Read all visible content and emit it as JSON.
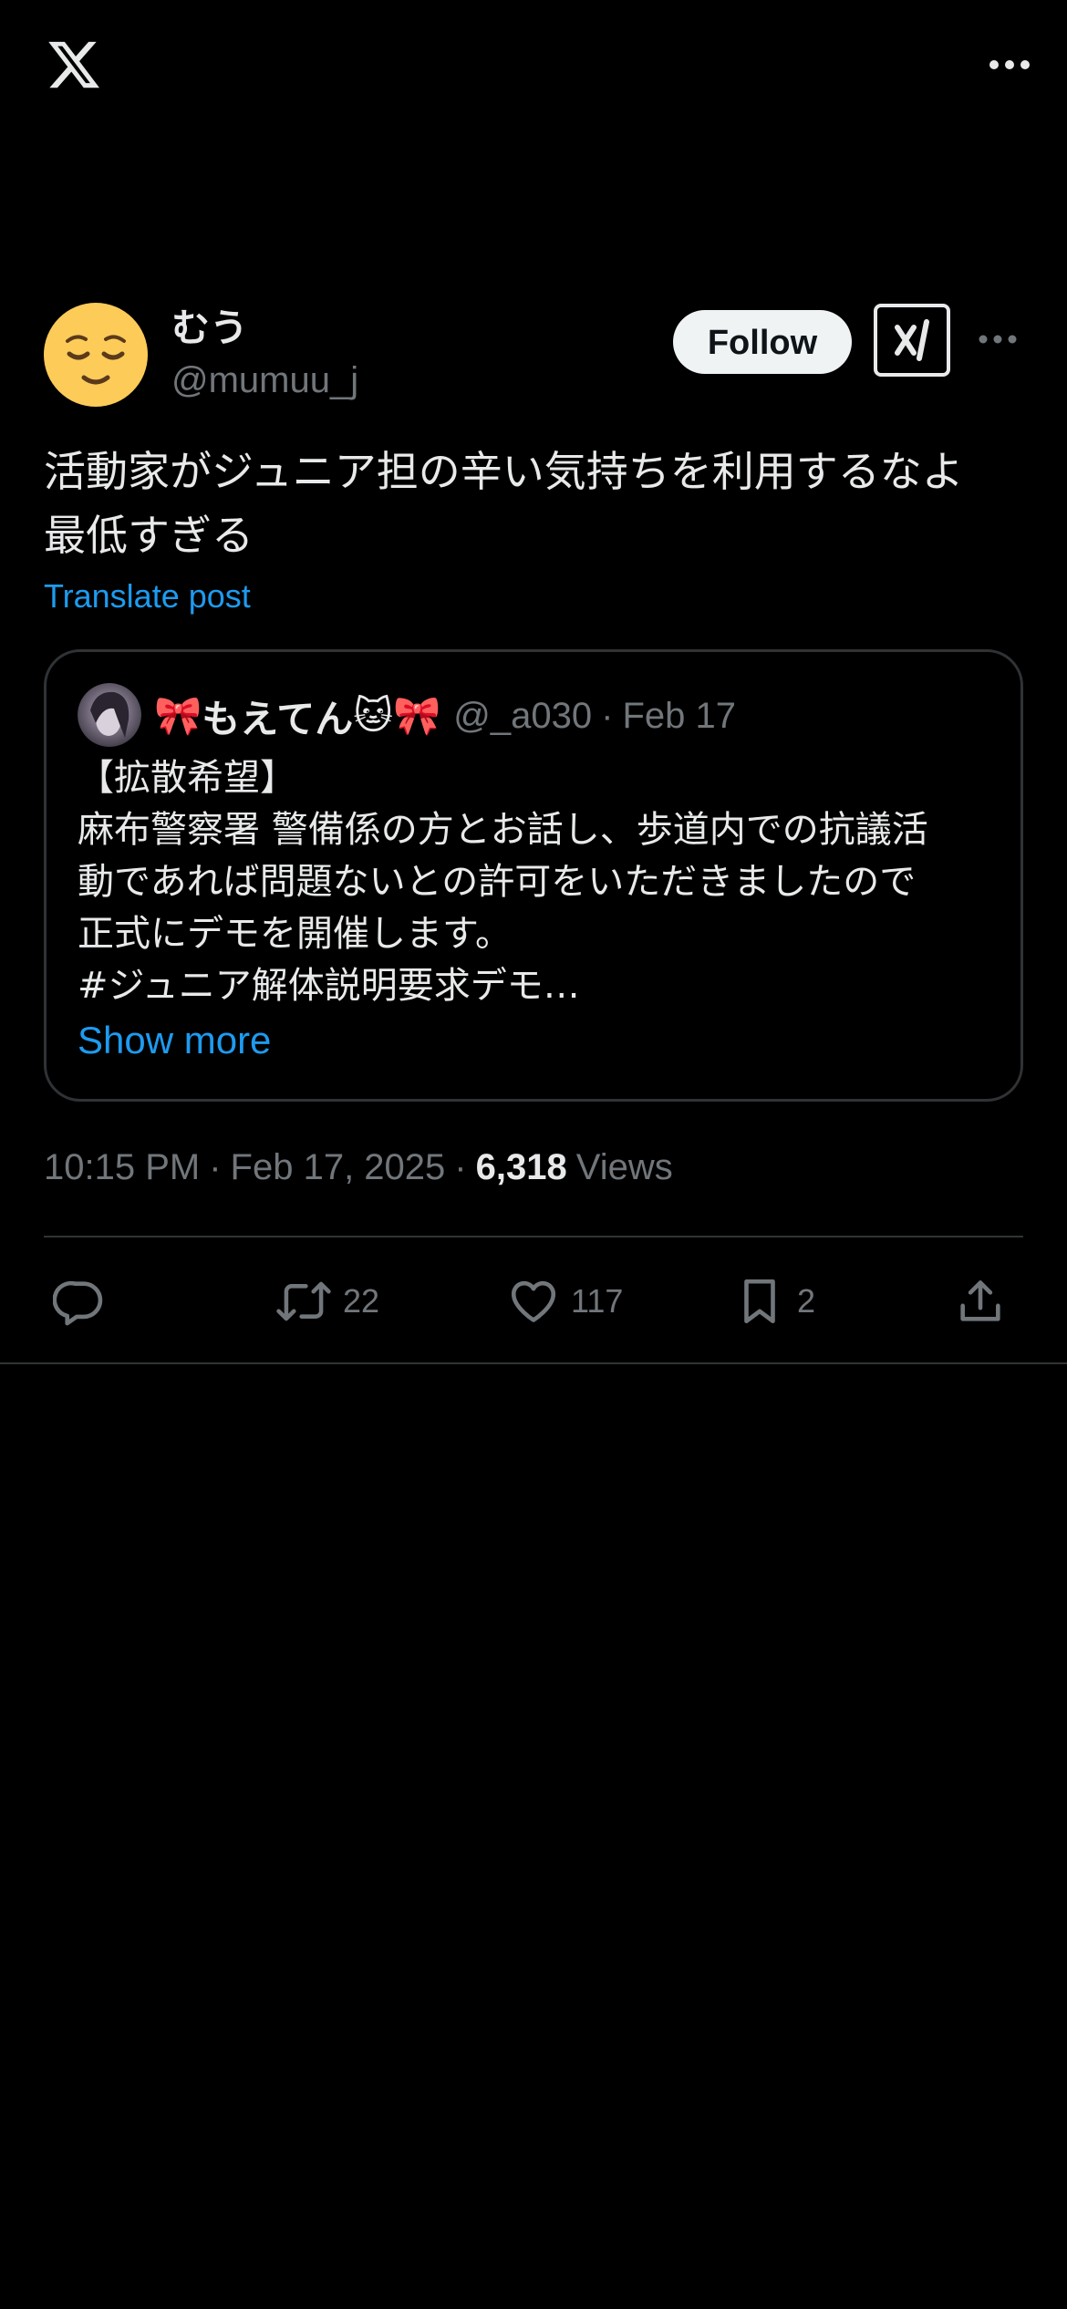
{
  "topbar": {
    "logo_icon": "x-logo-icon",
    "more_icon": "more-horizontal-icon"
  },
  "post": {
    "author": {
      "display_name": "むう",
      "handle": "@mumuu_j",
      "avatar_icon": "relieved-face-emoji"
    },
    "follow_label": "Follow",
    "grok_icon": "grok-icon",
    "text": "活動家がジュニア担の辛い気持ちを利用するなよ\n最低すぎる",
    "translate_label": "Translate post",
    "quote": {
      "name_prefix_emoji": "🎀",
      "name": "もえてん",
      "name_suffix_emoji": "🐱🎀",
      "handle": "@_a030",
      "date": "Feb 17",
      "body": "【拡散希望】\n麻布警察署 警備係の方とお話し、歩道内での抗議活\n動であれば問題ないとの許可をいただきましたので\n正式にデモを開催します。\n#ジュニア解体説明要求デモ…",
      "show_more_label": "Show more"
    },
    "time": "10:15 PM",
    "date": "Feb 17, 2025",
    "views_count": "6,318",
    "views_label": "Views",
    "actions": {
      "reply_count": "",
      "retweet_count": "22",
      "like_count": "117",
      "bookmark_count": "2"
    }
  },
  "colors": {
    "background": "#000000",
    "text_primary": "#e7e9ea",
    "text_secondary": "#71767b",
    "accent": "#1d9bf0",
    "border": "#2f3336",
    "avatar_yellow": "#fdcb58"
  }
}
